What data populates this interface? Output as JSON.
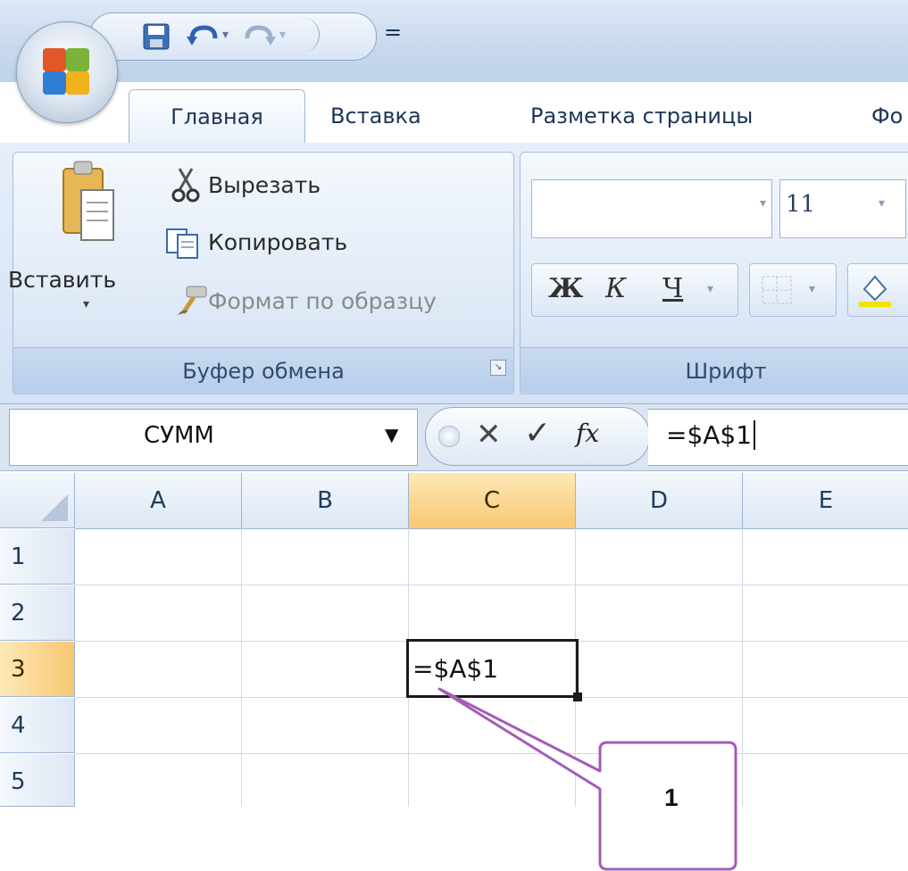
{
  "qat": {
    "separator": "="
  },
  "tabs": [
    {
      "label": "Главная"
    },
    {
      "label": "Вставка"
    },
    {
      "label": "Разметка страницы"
    },
    {
      "label": "Фо"
    }
  ],
  "clipboard": {
    "paste_label": "Вставить",
    "cut_label": "Вырезать",
    "copy_label": "Копировать",
    "format_painter_label": "Формат по образцу",
    "group_label": "Буфер обмена"
  },
  "font": {
    "font_name": "",
    "font_size": "11",
    "bold_label": "Ж",
    "italic_label": "К",
    "underline_label": "Ч",
    "group_label": "Шрифт"
  },
  "formula_bar": {
    "name_box": "СУММ",
    "cancel_glyph": "✕",
    "enter_glyph": "✓",
    "fx_label": "fx",
    "formula": "=$A$1"
  },
  "grid": {
    "columns": [
      "A",
      "B",
      "C",
      "D",
      "E"
    ],
    "rows": [
      "1",
      "2",
      "3",
      "4",
      "5"
    ],
    "active_cell_text": "=$A$1"
  },
  "callout": {
    "label": "1"
  },
  "colors": {
    "selected_header": "#f8c772",
    "callout_stroke": "#a35cb8",
    "ribbon_blue": "#d4e2f4"
  }
}
